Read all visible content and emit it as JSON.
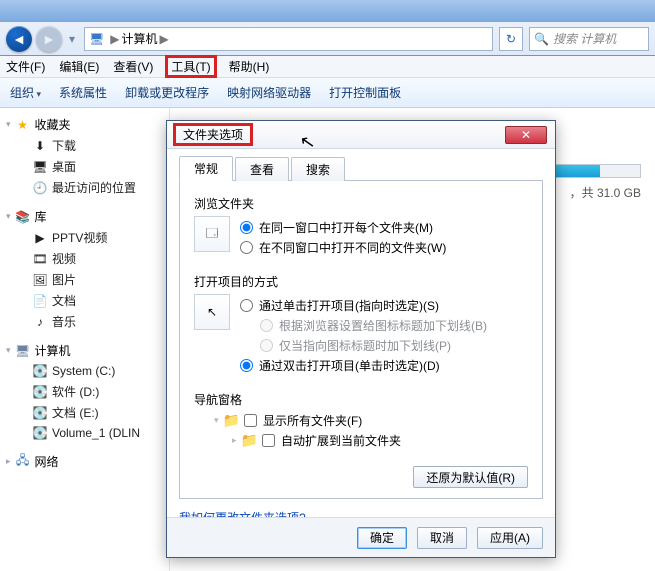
{
  "addressbar": {
    "location": "计算机",
    "sep": "▶"
  },
  "search": {
    "placeholder": "搜索 计算机"
  },
  "menubar": {
    "file": "文件(F)",
    "edit": "编辑(E)",
    "view": "查看(V)",
    "tools": "工具(T)",
    "help": "帮助(H)"
  },
  "toolbar": {
    "organize": "组织",
    "props": "系统属性",
    "uninstall": "卸载或更改程序",
    "map_drive": "映射网络驱动器",
    "control_panel": "打开控制面板"
  },
  "sidebar": {
    "favorites": {
      "header": "收藏夹",
      "items": [
        "下载",
        "桌面",
        "最近访问的位置"
      ]
    },
    "libraries": {
      "header": "库",
      "items": [
        "PPTV视频",
        "视频",
        "图片",
        "文档",
        "音乐"
      ]
    },
    "computer": {
      "header": "计算机",
      "items": [
        "System (C:)",
        "软件 (D:)",
        "文档 (E:)",
        "Volume_1 (DLIN"
      ]
    },
    "network": {
      "header": "网络"
    }
  },
  "main": {
    "capacity_suffix": "，共 31.0 GB"
  },
  "dialog": {
    "title": "文件夹选项",
    "tabs": {
      "general": "常规",
      "view": "查看",
      "search": "搜索"
    },
    "browse": {
      "title": "浏览文件夹",
      "same_window": "在同一窗口中打开每个文件夹(M)",
      "diff_window": "在不同窗口中打开不同的文件夹(W)"
    },
    "click": {
      "title": "打开项目的方式",
      "single": "通过单击打开项目(指向时选定)(S)",
      "single_sub1": "根据浏览器设置给图标标题加下划线(B)",
      "single_sub2": "仅当指向图标标题时加下划线(P)",
      "double": "通过双击打开项目(单击时选定)(D)"
    },
    "navpane": {
      "title": "导航窗格",
      "show_all": "显示所有文件夹(F)",
      "auto_expand": "自动扩展到当前文件夹"
    },
    "restore": "还原为默认值(R)",
    "help_link": "我如何更改文件夹选项?",
    "buttons": {
      "ok": "确定",
      "cancel": "取消",
      "apply": "应用(A)"
    }
  }
}
